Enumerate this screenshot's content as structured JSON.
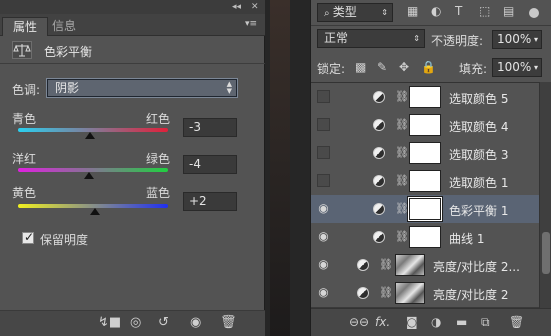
{
  "left_panel": {
    "tabs": [
      {
        "label": "属性"
      },
      {
        "label": "信息"
      }
    ],
    "adjustment_title": "色彩平衡",
    "tone_label": "色调:",
    "tone_value": "阴影",
    "sliders": [
      {
        "left_label": "青色",
        "right_label": "红色",
        "value": "-3",
        "colors": [
          "#2ad0f0",
          "#e0203a"
        ],
        "position": 0.48
      },
      {
        "left_label": "洋红",
        "right_label": "绿色",
        "value": "-4",
        "colors": [
          "#e020e0",
          "#20d040"
        ],
        "position": 0.47
      },
      {
        "left_label": "黄色",
        "right_label": "蓝色",
        "value": "+2",
        "colors": [
          "#f0f020",
          "#2030f0"
        ],
        "position": 0.51
      }
    ],
    "preserve_label": "保留明度",
    "preserve_checked": true
  },
  "right_panel": {
    "filter_kind": "类型",
    "blend_mode": "正常",
    "opacity_label": "不透明度:",
    "opacity_value": "100%",
    "lock_label": "锁定:",
    "fill_label": "填充:",
    "fill_value": "100%",
    "layers": [
      {
        "name": "选取颜色 5",
        "visible": false,
        "type": "adjustment",
        "selected": false
      },
      {
        "name": "选取颜色 4",
        "visible": false,
        "type": "adjustment",
        "selected": false
      },
      {
        "name": "选取颜色 3",
        "visible": false,
        "type": "adjustment",
        "selected": false
      },
      {
        "name": "选取颜色 1",
        "visible": false,
        "type": "adjustment",
        "selected": false
      },
      {
        "name": "色彩平衡 1",
        "visible": true,
        "type": "adjustment",
        "selected": true
      },
      {
        "name": "曲线 1",
        "visible": true,
        "type": "adjustment",
        "selected": false
      },
      {
        "name": "亮度/对比度 2...",
        "visible": true,
        "type": "photo",
        "selected": false
      },
      {
        "name": "亮度/对比度 2",
        "visible": true,
        "type": "photo",
        "selected": false
      }
    ]
  },
  "colors": {
    "panel_bg": "#535353",
    "selected_layer": "#5a6474",
    "select_border": "#7c8796"
  },
  "icons": [
    "balance-icon",
    "eye-icon",
    "link-icon",
    "lock-icon",
    "fx-icon",
    "mask-icon",
    "trash-icon",
    "folder-icon",
    "new-layer-icon"
  ]
}
